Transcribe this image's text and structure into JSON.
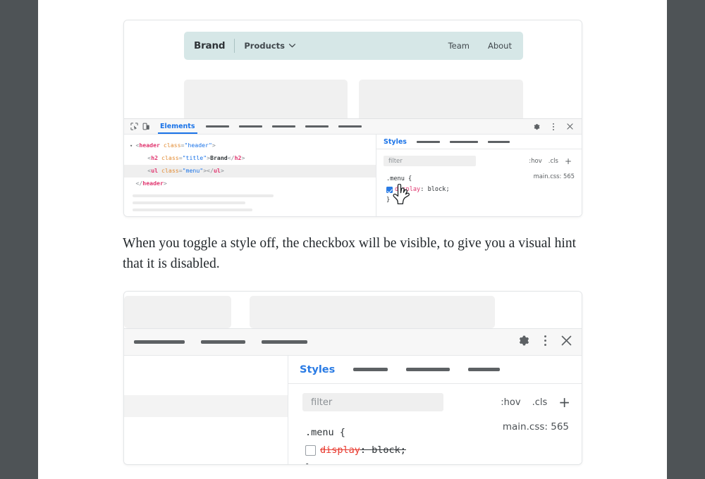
{
  "page": {
    "background": "#4e5356",
    "paper": "#ffffff"
  },
  "caption": {
    "text": "When you toggle a style off, the checkbox will be visible, to give you a visual hint that it is disabled."
  },
  "figure_one": {
    "site_preview": {
      "navbar": {
        "brand": "Brand",
        "dropdown_label": "Products",
        "dropdown_icon": "chevron-down-icon",
        "links": [
          "Team",
          "About"
        ],
        "background": "#d6e7e7"
      },
      "hero_placeholders": 2
    },
    "devtools": {
      "toolbar": {
        "inspect_icon": "inspect-element-icon",
        "device_icon": "device-toolbar-icon",
        "active_tab": "Elements",
        "redacted_tabs": 5,
        "settings_icon": "gear-icon",
        "more_icon": "kebab-menu-icon",
        "close_icon": "close-icon"
      },
      "dom": {
        "lines": [
          {
            "indent": 0,
            "triangle": "▾",
            "parts": [
              {
                "t": "punct",
                "s": "<"
              },
              {
                "t": "tag",
                "s": "header"
              },
              {
                "t": "space",
                "s": " "
              },
              {
                "t": "attr",
                "s": "class"
              },
              {
                "t": "punct",
                "s": "="
              },
              {
                "t": "val",
                "s": "\"header\""
              },
              {
                "t": "punct",
                "s": ">"
              }
            ],
            "selected": false
          },
          {
            "indent": 1,
            "triangle": "",
            "parts": [
              {
                "t": "punct",
                "s": "<"
              },
              {
                "t": "tag",
                "s": "h2"
              },
              {
                "t": "space",
                "s": " "
              },
              {
                "t": "attr",
                "s": "class"
              },
              {
                "t": "punct",
                "s": "="
              },
              {
                "t": "val",
                "s": "\"title\""
              },
              {
                "t": "punct",
                "s": ">"
              },
              {
                "t": "txt",
                "s": "Brand"
              },
              {
                "t": "punct",
                "s": "</"
              },
              {
                "t": "tag",
                "s": "h2"
              },
              {
                "t": "punct",
                "s": ">"
              }
            ],
            "selected": false
          },
          {
            "indent": 1,
            "triangle": "",
            "parts": [
              {
                "t": "punct",
                "s": "<"
              },
              {
                "t": "tag",
                "s": "ul"
              },
              {
                "t": "space",
                "s": " "
              },
              {
                "t": "attr",
                "s": "class"
              },
              {
                "t": "punct",
                "s": "="
              },
              {
                "t": "val",
                "s": "\"menu\""
              },
              {
                "t": "punct",
                "s": ">"
              },
              {
                "t": "punct",
                "s": "</"
              },
              {
                "t": "tag",
                "s": "ul"
              },
              {
                "t": "punct",
                "s": ">"
              }
            ],
            "selected": true
          },
          {
            "indent": 0,
            "triangle": "",
            "parts": [
              {
                "t": "punct",
                "s": "</"
              },
              {
                "t": "tag",
                "s": "header"
              },
              {
                "t": "punct",
                "s": ">"
              }
            ],
            "selected": false
          }
        ],
        "ghost_lines": [
          200,
          160,
          170
        ]
      },
      "styles": {
        "tab_label": "Styles",
        "redacted_tabs": 3,
        "filter_placeholder": "filter",
        "actions": [
          ":hov",
          ".cls"
        ],
        "add_icon": "plus-icon",
        "source": "main.css: 565",
        "rule": {
          "selector_open": ".menu {",
          "close_brace": "}",
          "checkbox_state": "checked",
          "property": "display",
          "value": "block;",
          "disabled": false
        },
        "cursor_icon": "pointing-hand-cursor"
      }
    }
  },
  "figure_two": {
    "placeholders": 2,
    "devtools": {
      "toolbar": {
        "redacted_tabs": 3,
        "settings_icon": "gear-icon",
        "more_icon": "kebab-menu-icon",
        "close_icon": "close-icon"
      },
      "styles": {
        "tab_label": "Styles",
        "redacted_tabs": 3,
        "filter_placeholder": "filter",
        "actions": [
          ":hov",
          ".cls"
        ],
        "add_icon": "plus-icon",
        "source": "main.css: 565",
        "rule": {
          "selector_open": ".menu {",
          "close_brace": "}",
          "checkbox_state": "unchecked",
          "property": "display",
          "separator": ": ",
          "value": "block;",
          "disabled": true
        }
      }
    }
  },
  "colors": {
    "accent_blue": "#1a73e8",
    "nav_bg": "#d6e7e7",
    "tag_pink": "#e0366f",
    "attr_orange": "#e28b33",
    "value_blue": "#1a73e8",
    "disabled_red": "#e8392e",
    "checkbox_blue": "#2a7be4"
  }
}
